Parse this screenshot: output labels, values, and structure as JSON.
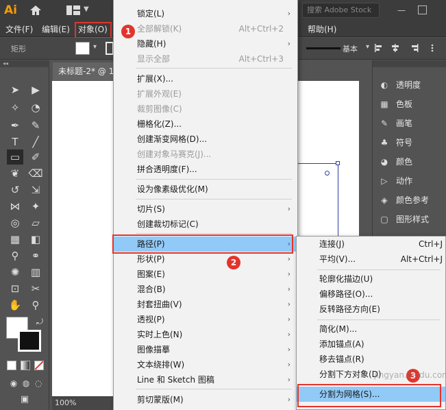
{
  "app": {
    "logo": "Ai",
    "search_placeholder": "搜索 Adobe Stock"
  },
  "menubar": {
    "items": [
      "文件(F)",
      "编辑(E)",
      "对象(O)",
      "帮助(H)"
    ]
  },
  "control": {
    "shape_label": "矩形",
    "stroke_style": "基本"
  },
  "document": {
    "tab_title": "未标题-2* @ 1",
    "zoom": "100%"
  },
  "object_menu": {
    "items": [
      {
        "label": "锁定(L)",
        "shortcut": "",
        "submenu": true,
        "disabled": false
      },
      {
        "label": "全部解锁(K)",
        "shortcut": "Alt+Ctrl+2",
        "submenu": false,
        "disabled": true
      },
      {
        "label": "隐藏(H)",
        "shortcut": "",
        "submenu": true,
        "disabled": false
      },
      {
        "label": "显示全部",
        "shortcut": "Alt+Ctrl+3",
        "submenu": false,
        "disabled": true
      },
      {
        "label": "扩展(X)...",
        "shortcut": "",
        "submenu": false,
        "disabled": false
      },
      {
        "label": "扩展外观(E)",
        "shortcut": "",
        "submenu": false,
        "disabled": true
      },
      {
        "label": "裁剪图像(C)",
        "shortcut": "",
        "submenu": false,
        "disabled": true
      },
      {
        "label": "栅格化(Z)...",
        "shortcut": "",
        "submenu": false,
        "disabled": false
      },
      {
        "label": "创建渐变网格(D)...",
        "shortcut": "",
        "submenu": false,
        "disabled": false
      },
      {
        "label": "创建对象马赛克(J)...",
        "shortcut": "",
        "submenu": false,
        "disabled": true
      },
      {
        "label": "拼合透明度(F)...",
        "shortcut": "",
        "submenu": false,
        "disabled": false
      },
      {
        "label": "设为像素级优化(M)",
        "shortcut": "",
        "submenu": false,
        "disabled": false
      },
      {
        "label": "切片(S)",
        "shortcut": "",
        "submenu": true,
        "disabled": false
      },
      {
        "label": "创建裁切标记(C)",
        "shortcut": "",
        "submenu": false,
        "disabled": false
      },
      {
        "label": "路径(P)",
        "shortcut": "",
        "submenu": true,
        "disabled": false,
        "selected": true
      },
      {
        "label": "形状(P)",
        "shortcut": "",
        "submenu": true,
        "disabled": false
      },
      {
        "label": "图案(E)",
        "shortcut": "",
        "submenu": true,
        "disabled": false
      },
      {
        "label": "混合(B)",
        "shortcut": "",
        "submenu": true,
        "disabled": false
      },
      {
        "label": "封套扭曲(V)",
        "shortcut": "",
        "submenu": true,
        "disabled": false
      },
      {
        "label": "透视(P)",
        "shortcut": "",
        "submenu": true,
        "disabled": false
      },
      {
        "label": "实时上色(N)",
        "shortcut": "",
        "submenu": true,
        "disabled": false
      },
      {
        "label": "图像描摹",
        "shortcut": "",
        "submenu": true,
        "disabled": false
      },
      {
        "label": "文本绕排(W)",
        "shortcut": "",
        "submenu": true,
        "disabled": false
      },
      {
        "label": "Line 和 Sketch 图稿",
        "shortcut": "",
        "submenu": true,
        "disabled": false
      },
      {
        "label": "剪切蒙版(M)",
        "shortcut": "",
        "submenu": true,
        "disabled": false
      }
    ]
  },
  "path_submenu": {
    "items": [
      {
        "label": "连接(J)",
        "shortcut": "Ctrl+J"
      },
      {
        "label": "平均(V)...",
        "shortcut": "Alt+Ctrl+J"
      },
      {
        "label": "轮廓化描边(U)",
        "shortcut": ""
      },
      {
        "label": "偏移路径(O)...",
        "shortcut": ""
      },
      {
        "label": "反转路径方向(E)",
        "shortcut": ""
      },
      {
        "label": "简化(M)...",
        "shortcut": ""
      },
      {
        "label": "添加锚点(A)",
        "shortcut": ""
      },
      {
        "label": "移去锚点(R)",
        "shortcut": ""
      },
      {
        "label": "分割下方对象(D)",
        "shortcut": ""
      },
      {
        "label": "分割为网格(S)...",
        "shortcut": "",
        "selected": true
      }
    ]
  },
  "panels": {
    "items": [
      "透明度",
      "色板",
      "画笔",
      "符号",
      "颜色",
      "动作",
      "颜色参考",
      "图形样式"
    ]
  },
  "annotations": {
    "badges": [
      "1",
      "2",
      "3"
    ],
    "watermark": "jingyan.baidu.com"
  },
  "colors": {
    "highlight": "#91c9f7",
    "annotation": "#e2342c",
    "logo": "#ff9a00"
  }
}
